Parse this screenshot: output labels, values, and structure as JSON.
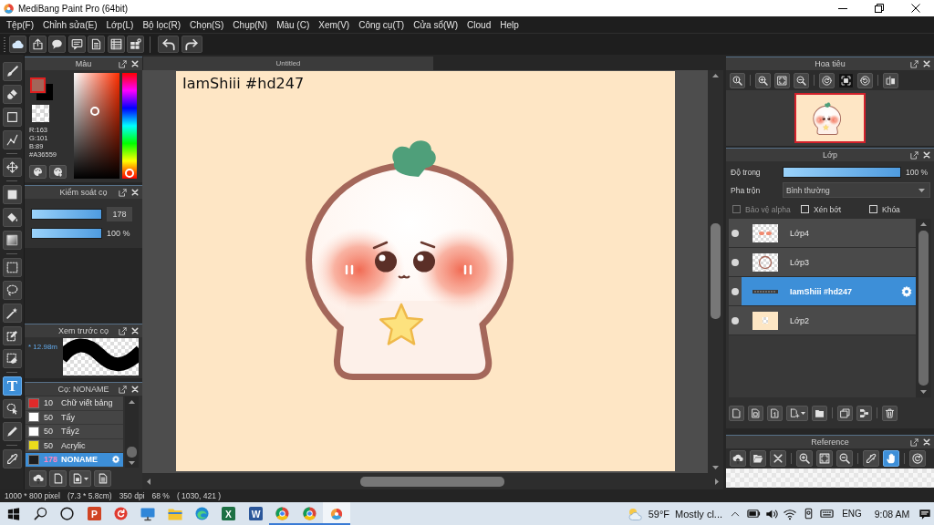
{
  "window": {
    "title": "MediBang Paint Pro (64bit)"
  },
  "menu": [
    "Tệp(F)",
    "Chỉnh sửa(E)",
    "Lớp(L)",
    "Bộ lọc(R)",
    "Chọn(S)",
    "Chụp(N)",
    "Màu (C)",
    "Xem(V)",
    "Công cụ(T)",
    "Cửa sổ(W)",
    "Cloud",
    "Help"
  ],
  "tools": [
    [
      {
        "kind": "brush",
        "selected": false
      },
      {
        "kind": "eraser",
        "selected": false
      },
      {
        "kind": "square",
        "selected": false
      },
      {
        "kind": "polyline",
        "selected": false
      }
    ],
    [
      {
        "kind": "move",
        "selected": false
      }
    ],
    [
      {
        "kind": "fill-square",
        "selected": false
      },
      {
        "kind": "bucket",
        "selected": false
      },
      {
        "kind": "gradient",
        "selected": false
      }
    ],
    [
      {
        "kind": "select",
        "selected": false
      },
      {
        "kind": "lasso",
        "selected": false
      },
      {
        "kind": "wand",
        "selected": false
      },
      {
        "kind": "select-pen",
        "selected": false
      },
      {
        "kind": "select-eraser",
        "selected": false
      }
    ],
    [
      {
        "kind": "text",
        "glyph": "T",
        "selected": true
      },
      {
        "kind": "lasso-cursor",
        "selected": false
      },
      {
        "kind": "pen",
        "selected": false
      }
    ],
    [
      {
        "kind": "dropper",
        "selected": false
      }
    ]
  ],
  "color_panel": {
    "title": "Màu",
    "swatches": [
      {
        "kind": "foreground",
        "color": "#a36559",
        "selected": true
      },
      {
        "kind": "background",
        "color": "#000000",
        "selected": false
      },
      {
        "kind": "transparent",
        "selected": false
      }
    ],
    "hue_slider": {
      "level": 0.03
    },
    "readout": [
      "R:163",
      "G:101",
      "B:89",
      "#A36559"
    ]
  },
  "brush_control": {
    "title": "Kiểm soát cọ",
    "sliders": [
      {
        "kind": "field",
        "level": 1,
        "reading": "178"
      },
      {
        "kind": "label",
        "level": 1,
        "reading": "100 %"
      }
    ]
  },
  "brush_preview": {
    "title": "Xem trước cọ",
    "size": "* 12.98m"
  },
  "brush_list": {
    "title": "Cọ: NONAME",
    "brushes": [
      {
        "size": "10",
        "name": "Chữ viết bảng",
        "color": "#e02a2a",
        "selected": false
      },
      {
        "size": "50",
        "name": "Tẩy",
        "color": "#ffffff",
        "selected": false
      },
      {
        "size": "50",
        "name": "Tẩy2",
        "color": "#ffffff",
        "selected": false
      },
      {
        "size": "50",
        "name": "Acrylic",
        "color": "#ecdc1c",
        "selected": false
      },
      {
        "size": "178",
        "name": "NONAME",
        "color": "#1e1e1e",
        "selected": true
      }
    ]
  },
  "canvas": {
    "tab": "Untitled",
    "caption": "IamShiii #hd247"
  },
  "navigator": {
    "title": "Hoa tiêu",
    "tools": [
      [
        {
          "kind": "zoom-actual",
          "selected": false
        }
      ],
      [
        {
          "kind": "zoom-in",
          "selected": false
        },
        {
          "kind": "fit",
          "selected": false
        },
        {
          "kind": "zoom-out",
          "selected": false
        }
      ],
      [
        {
          "kind": "rotate-left",
          "selected": false
        },
        {
          "kind": "fit-screen",
          "selected": true
        },
        {
          "kind": "rotate-right",
          "selected": false
        }
      ],
      [
        {
          "kind": "flip",
          "selected": false
        }
      ]
    ]
  },
  "layers": {
    "title": "Lớp",
    "opacity": {
      "label": "Độ trong",
      "level": 1,
      "reading": "100 %"
    },
    "blend": {
      "label": "Pha trộn",
      "value": "Bình thường"
    },
    "options": [
      {
        "label": "Bảo vệ alpha",
        "checked": false,
        "disabled": true
      },
      {
        "label": "Xén bớt",
        "checked": false,
        "disabled": false
      },
      {
        "label": "Khóa",
        "checked": false,
        "disabled": false
      }
    ],
    "items": [
      {
        "name": "Lớp4",
        "kind": "raster",
        "visible": true,
        "selected": false
      },
      {
        "name": "Lớp3",
        "kind": "raster",
        "visible": true,
        "selected": false
      },
      {
        "name": "IamShiii #hd247",
        "kind": "text",
        "visible": true,
        "selected": true
      },
      {
        "name": "Lớp2",
        "kind": "raster",
        "visible": true,
        "selected": false
      }
    ]
  },
  "reference": {
    "title": "Reference",
    "tools": [
      [
        {
          "kind": "cloud-upload",
          "selected": false
        },
        {
          "kind": "folder-open",
          "selected": false
        },
        {
          "kind": "close",
          "selected": false
        }
      ],
      [
        {
          "kind": "zoom-in",
          "selected": false
        },
        {
          "kind": "fit",
          "selected": false
        },
        {
          "kind": "zoom-out",
          "selected": false
        }
      ],
      [
        {
          "kind": "dropper",
          "selected": false
        },
        {
          "kind": "hand",
          "selected": true
        }
      ],
      [
        {
          "kind": "rotate",
          "selected": false
        }
      ]
    ]
  },
  "status_bar": [
    "1000 * 800 pixel",
    "(7.3 * 5.8cm)",
    "350 dpi",
    "68 %",
    "( 1030, 421 )"
  ],
  "taskbar": {
    "apps": [
      {
        "kind": "tile",
        "letter": "P",
        "color": "#d04423",
        "running": false,
        "selected": false
      },
      {
        "kind": "circle-arrow",
        "running": false,
        "selected": false
      },
      {
        "kind": "monitor",
        "running": false,
        "selected": false
      },
      {
        "kind": "folder",
        "running": false,
        "selected": false
      },
      {
        "kind": "wave",
        "running": false,
        "selected": false
      },
      {
        "kind": "tile",
        "letter": "X",
        "color": "#1d7044",
        "running": false,
        "selected": false
      },
      {
        "kind": "tile",
        "letter": "W",
        "color": "#2b579a",
        "running": false,
        "selected": false
      },
      {
        "kind": "ring",
        "running": true,
        "selected": false
      },
      {
        "kind": "ring",
        "running": true,
        "selected": false
      },
      {
        "kind": "drop",
        "running": true,
        "selected": true
      }
    ],
    "weather": {
      "temperature": "59°F",
      "condition": "Mostly cl..."
    },
    "language": "ENG",
    "time": "9:08 AM"
  }
}
